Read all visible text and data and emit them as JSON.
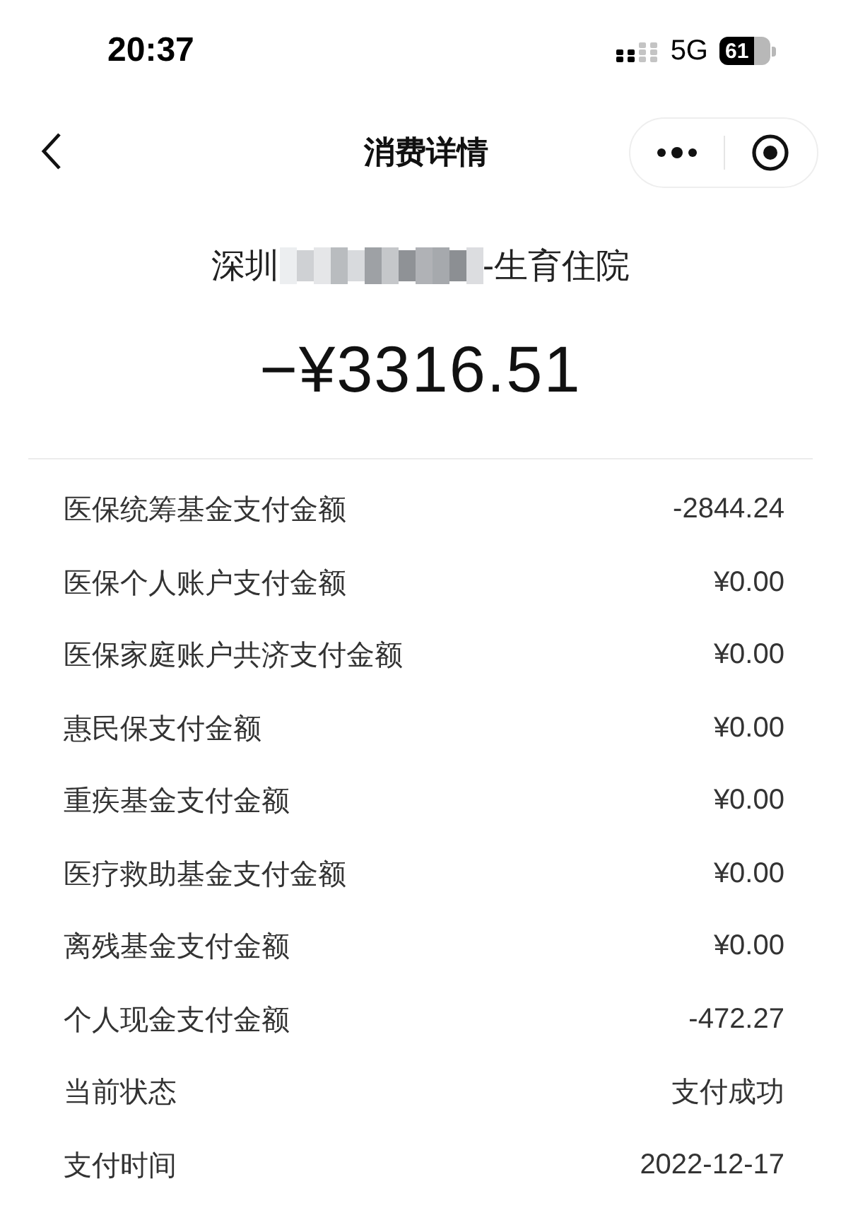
{
  "status_bar": {
    "time": "20:37",
    "network": "5G",
    "battery": "61"
  },
  "nav_bar": {
    "title": "消费详情"
  },
  "merchant": {
    "prefix": "深圳",
    "suffix": "-生育住院"
  },
  "amount": "−¥3316.51",
  "details": [
    {
      "label": "医保统筹基金支付金额",
      "value": "-2844.24"
    },
    {
      "label": "医保个人账户支付金额",
      "value": "¥0.00"
    },
    {
      "label": "医保家庭账户共济支付金额",
      "value": "¥0.00"
    },
    {
      "label": "惠民保支付金额",
      "value": "¥0.00"
    },
    {
      "label": "重疾基金支付金额",
      "value": "¥0.00"
    },
    {
      "label": "医疗救助基金支付金额",
      "value": "¥0.00"
    },
    {
      "label": "离残基金支付金额",
      "value": "¥0.00"
    },
    {
      "label": "个人现金支付金额",
      "value": "-472.27"
    },
    {
      "label": "当前状态",
      "value": "支付成功"
    },
    {
      "label": "支付时间",
      "value": "2022-12-17"
    }
  ]
}
